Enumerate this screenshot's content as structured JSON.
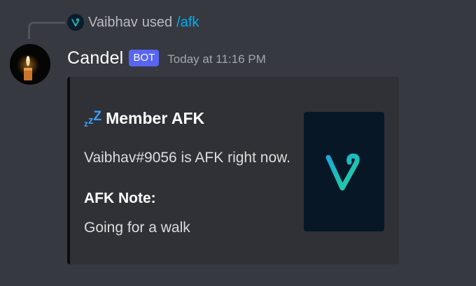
{
  "reply": {
    "user": "Vaibhav",
    "used": "used",
    "command": "/afk"
  },
  "message": {
    "author": "Candel",
    "badge": "BOT",
    "timestamp": "Today at 11:16 PM"
  },
  "embed": {
    "title": "Member AFK",
    "description": "Vaibhav#9056 is AFK right now.",
    "field_name": "AFK Note:",
    "field_value": "Going for a walk"
  },
  "icons": {
    "zzz": "sleeping-zzz-icon",
    "thumbnail": "v-logo-icon"
  },
  "colors": {
    "background": "#36393f",
    "embed_bg": "#2f3136",
    "embed_border": "#0c0c0c",
    "bot_badge": "#5865f2",
    "command_link": "#00aff4",
    "zzz": "#3aa0ff",
    "logo_gradient_start": "#1ea8d8",
    "logo_gradient_end": "#1fd39c"
  }
}
